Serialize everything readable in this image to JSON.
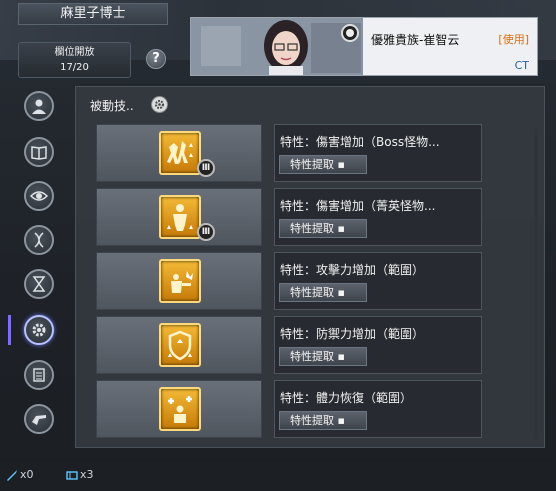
{
  "header": {
    "name": "麻里子博士",
    "slot_label": "欄位開放",
    "slot_count": "17/20",
    "help": "?"
  },
  "character": {
    "name": "優雅貴族-崔智云",
    "use_label": "[使用]",
    "tag": "CT"
  },
  "sidebar": [
    {
      "icon": "person-icon"
    },
    {
      "icon": "book-icon"
    },
    {
      "icon": "eye-icon"
    },
    {
      "icon": "dna-icon"
    },
    {
      "icon": "hourglass-icon"
    },
    {
      "icon": "gear-icon",
      "active": true
    },
    {
      "icon": "list-icon"
    },
    {
      "icon": "revolver-icon"
    }
  ],
  "panel": {
    "title": "被動技..",
    "skills": [
      {
        "trait": "特性：傷害增加（Boss怪物...",
        "button": "特性提取 ▪",
        "tier": "Ⅲ",
        "icon": "boss-damage-icon"
      },
      {
        "trait": "特性：傷害增加（菁英怪物...",
        "button": "特性提取 ▪",
        "tier": "Ⅲ",
        "icon": "elite-damage-icon"
      },
      {
        "trait": "特性：攻擊力增加（範圍）",
        "button": "特性提取 ▪",
        "tier": "",
        "icon": "attack-up-icon"
      },
      {
        "trait": "特性：防禦力增加（範圍）",
        "button": "特性提取 ▪",
        "tier": "",
        "icon": "defense-up-icon"
      },
      {
        "trait": "特性：體力恢復（範圍）",
        "button": "特性提取 ▪",
        "tier": "",
        "icon": "hp-recovery-icon"
      }
    ]
  },
  "footer": {
    "item1_count": "x0",
    "item2_count": "x3"
  }
}
